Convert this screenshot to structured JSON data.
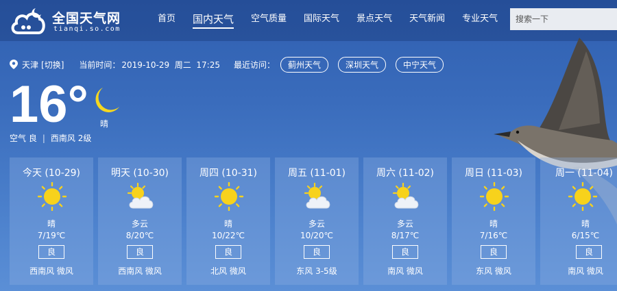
{
  "logo": {
    "title": "全国天气网",
    "subtitle": "tianqi.so.com",
    "icon": "cloud-logo-icon"
  },
  "nav": [
    "首页",
    "国内天气",
    "空气质量",
    "国际天气",
    "景点天气",
    "天气新闻",
    "专业天气"
  ],
  "nav_active": "国内天气",
  "search": {
    "placeholder": "搜索一下"
  },
  "location": {
    "city": "天津",
    "switch": "[切换]",
    "time_label": "当前时间：",
    "time": "2019-10-29  周二  17:25",
    "recent_label": "最近访问：",
    "recent": [
      "蓟州天气",
      "深圳天气",
      "中宁天气"
    ]
  },
  "current": {
    "temp": "16°",
    "condition": "晴",
    "icon": "moon-icon",
    "air": "空气 良",
    "separator": "|",
    "wind": "西南风 2级"
  },
  "forecast": [
    {
      "date": "今天 (10-29)",
      "icon": "sun-icon",
      "cond": "晴",
      "temp": "7/19℃",
      "aqi": "良",
      "wind": "西南风 微风"
    },
    {
      "date": "明天 (10-30)",
      "icon": "partly-cloudy-icon",
      "cond": "多云",
      "temp": "8/20℃",
      "aqi": "良",
      "wind": "西南风 微风"
    },
    {
      "date": "周四 (10-31)",
      "icon": "sun-icon",
      "cond": "晴",
      "temp": "10/22℃",
      "aqi": "良",
      "wind": "北风 微风"
    },
    {
      "date": "周五 (11-01)",
      "icon": "partly-cloudy-icon",
      "cond": "多云",
      "temp": "10/20℃",
      "aqi": "良",
      "wind": "东风 3-5级"
    },
    {
      "date": "周六 (11-02)",
      "icon": "partly-cloudy-icon",
      "cond": "多云",
      "temp": "8/17℃",
      "aqi": "良",
      "wind": "南风 微风"
    },
    {
      "date": "周日 (11-03)",
      "icon": "sun-icon",
      "cond": "晴",
      "temp": "7/16℃",
      "aqi": "良",
      "wind": "东风 微风"
    },
    {
      "date": "周一 (11-04)",
      "icon": "sun-icon",
      "cond": "晴",
      "temp": "6/15℃",
      "aqi": "良",
      "wind": "南风 微风"
    }
  ],
  "colors": {
    "sun": "#f7d21c",
    "moon": "#f5d71f",
    "cloud": "#eef2f8"
  }
}
